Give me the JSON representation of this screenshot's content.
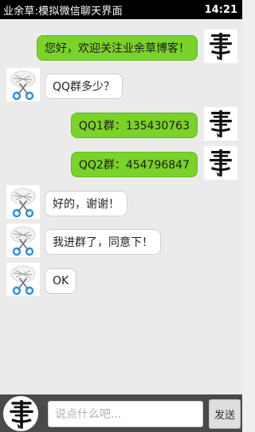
{
  "status_bar": {
    "title": "业余草:模拟微信聊天界面",
    "time": "14:21"
  },
  "messages": [
    {
      "side": "right",
      "text": "您好，欢迎关注业余草博客！",
      "avatar_icon": "calligraphy-logo-icon"
    },
    {
      "side": "left",
      "text": "QQ群多少？",
      "avatar_icon": "scissors-icon"
    },
    {
      "side": "right",
      "text": "QQ1群：135430763",
      "avatar_icon": "calligraphy-logo-icon"
    },
    {
      "side": "right",
      "text": "QQ2群：454796847",
      "avatar_icon": "calligraphy-logo-icon"
    },
    {
      "side": "left",
      "text": "好的，谢谢！",
      "avatar_icon": "scissors-icon"
    },
    {
      "side": "left",
      "text": "我进群了，同意下！",
      "avatar_icon": "scissors-icon"
    },
    {
      "side": "left",
      "text": "OK",
      "avatar_icon": "scissors-icon"
    }
  ],
  "input_bar": {
    "placeholder": "说点什么吧...",
    "value": "",
    "send_label": "发送",
    "avatar_icon": "calligraphy-logo-icon"
  },
  "colors": {
    "status_bar_bg": "#000000",
    "sent_bubble": "#7ad22a",
    "received_bubble": "#ffffff",
    "chat_bg": "#ebebeb",
    "input_bar_bg": "#4a4a4a"
  }
}
